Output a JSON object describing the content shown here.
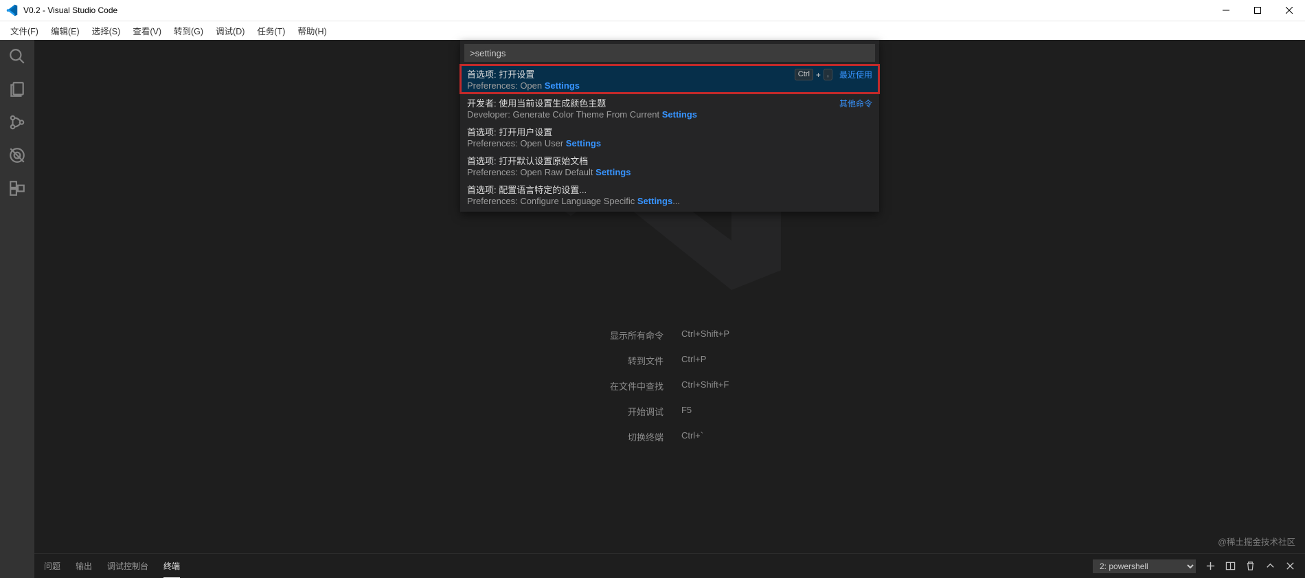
{
  "titlebar": {
    "title": "V0.2 - Visual Studio Code"
  },
  "menu": {
    "items": [
      "文件(F)",
      "编辑(E)",
      "选择(S)",
      "查看(V)",
      "转到(G)",
      "调试(D)",
      "任务(T)",
      "帮助(H)"
    ]
  },
  "palette": {
    "input": ">settings",
    "recent_label": "最近使用",
    "other_label": "其他命令",
    "key_ctrl": "Ctrl",
    "key_plus": "+",
    "key_comma": ",",
    "items": [
      {
        "title_cn": "首选项: 打开设置",
        "sub_pre": "Preferences: Open ",
        "sub_hl": "Settings",
        "sub_post": "",
        "selected": true,
        "keys": true,
        "hint": "recent"
      },
      {
        "title_cn": "开发者: 使用当前设置生成颜色主题",
        "sub_pre": "Developer: Generate Color Theme From Current ",
        "sub_hl": "Settings",
        "sub_post": "",
        "hint": "other"
      },
      {
        "title_cn": "首选项: 打开用户设置",
        "sub_pre": "Preferences: Open User ",
        "sub_hl": "Settings",
        "sub_post": ""
      },
      {
        "title_cn": "首选项: 打开默认设置原始文档",
        "sub_pre": "Preferences: Open Raw Default ",
        "sub_hl": "Settings",
        "sub_post": ""
      },
      {
        "title_cn": "首选项: 配置语言特定的设置...",
        "sub_pre": "Preferences: Configure Language Specific ",
        "sub_hl": "Settings",
        "sub_post": "..."
      }
    ]
  },
  "welcome": {
    "shortcuts": [
      {
        "label": "显示所有命令",
        "keys": "Ctrl+Shift+P"
      },
      {
        "label": "转到文件",
        "keys": "Ctrl+P"
      },
      {
        "label": "在文件中查找",
        "keys": "Ctrl+Shift+F"
      },
      {
        "label": "开始调试",
        "keys": "F5"
      },
      {
        "label": "切换终端",
        "keys": "Ctrl+`"
      }
    ]
  },
  "panel": {
    "tabs": {
      "problems": "问题",
      "output": "输出",
      "debug_console": "调试控制台",
      "terminal": "终端"
    },
    "terminal_selected": "2: powershell"
  },
  "watermark": "@稀土掘金技术社区"
}
